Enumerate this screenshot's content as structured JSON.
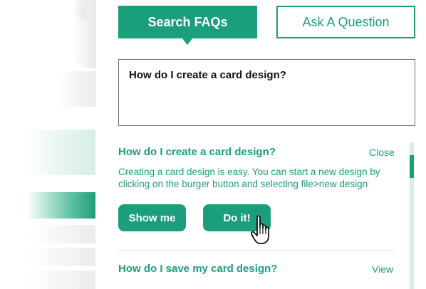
{
  "tabs": {
    "search_label": "Search FAQs",
    "ask_label": "Ask A Question"
  },
  "query": {
    "value": "How do I create a card design?"
  },
  "faqs": [
    {
      "question": "How do I create a card design?",
      "action": "Close",
      "answer": "Creating a card design is easy. You can start a new design by clicking on the burger button and selecting file>new design",
      "buttons": {
        "show_label": "Show me",
        "do_label": "Do it!"
      }
    },
    {
      "question": "How do I save my card design?",
      "action": "View"
    }
  ],
  "colors": {
    "accent": "#1a9e7b",
    "text_dark": "#111111",
    "border": "#707070"
  },
  "icons": {
    "cursor": "hand-pointer-icon",
    "tab_pointer": "caret-down-icon"
  }
}
